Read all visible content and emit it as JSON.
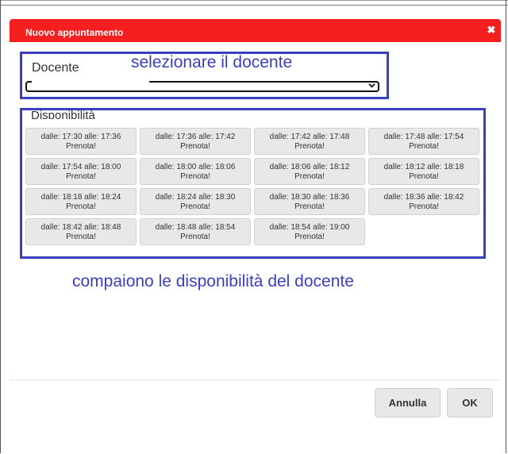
{
  "dialog": {
    "title": "Nuovo appuntamento",
    "close_glyph": "✖"
  },
  "docente": {
    "label": "Docente",
    "annotation": "selezionare il docente",
    "selected_value": ""
  },
  "disponibilita": {
    "label": "Disponibilità",
    "slots": [
      {
        "time": "dalle: 17:30 alle: 17:36",
        "action": "Prenota!"
      },
      {
        "time": "dalle: 17:36 alle: 17:42",
        "action": "Prenota!"
      },
      {
        "time": "dalle: 17:42 alle: 17:48",
        "action": "Prenota!"
      },
      {
        "time": "dalle: 17:48 alle: 17:54",
        "action": "Prenota!"
      },
      {
        "time": "dalle: 17:54 alle: 18:00",
        "action": "Prenota!"
      },
      {
        "time": "dalle: 18:00 alle: 18:06",
        "action": "Prenota!"
      },
      {
        "time": "dalle: 18:06 alle: 18:12",
        "action": "Prenota!"
      },
      {
        "time": "dalle: 18:12 alle: 18:18",
        "action": "Prenota!"
      },
      {
        "time": "dalle: 18:18 alle: 18:24",
        "action": "Prenota!"
      },
      {
        "time": "dalle: 18:24 alle: 18:30",
        "action": "Prenota!"
      },
      {
        "time": "dalle: 18:30 alle: 18:36",
        "action": "Prenota!"
      },
      {
        "time": "dalle: 18:36 alle: 18:42",
        "action": "Prenota!"
      },
      {
        "time": "dalle: 18:42 alle: 18:48",
        "action": "Prenota!"
      },
      {
        "time": "dalle: 18:48 alle: 18:54",
        "action": "Prenota!"
      },
      {
        "time": "dalle: 18:54 alle: 19:00",
        "action": "Prenota!"
      }
    ]
  },
  "annotation_bottom": "compaiono le disponibilità del docente",
  "footer": {
    "cancel_label": "Annulla",
    "ok_label": "OK"
  },
  "colors": {
    "header": "#f51f1f",
    "annotation": "#3a3fc0"
  }
}
